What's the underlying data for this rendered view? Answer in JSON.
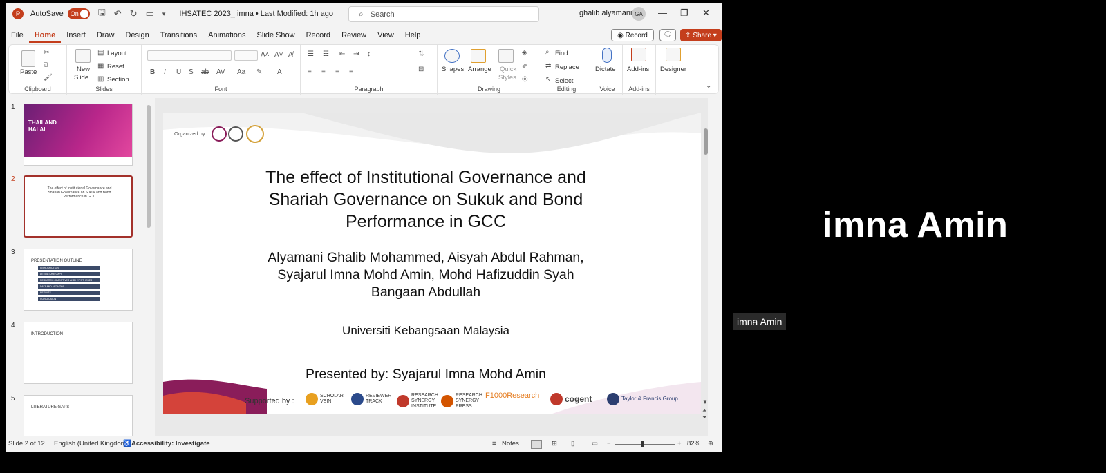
{
  "titlebar": {
    "autosave_label": "AutoSave",
    "autosave_state": "On",
    "doc_title": "IHSATEC 2023_ imna • Last Modified: 1h ago",
    "search_placeholder": "Search",
    "user_name": "ghalib alyamani",
    "user_initials": "GA"
  },
  "menu": [
    "File",
    "Home",
    "Insert",
    "Draw",
    "Design",
    "Transitions",
    "Animations",
    "Slide Show",
    "Record",
    "Review",
    "View",
    "Help"
  ],
  "menu_active": "Home",
  "actions": {
    "record": "Record",
    "share": "Share"
  },
  "ribbon": {
    "clipboard": {
      "label": "Clipboard",
      "paste": "Paste"
    },
    "slides": {
      "label": "Slides",
      "new_slide": "New",
      "new_slide2": "Slide",
      "layout": "Layout",
      "reset": "Reset",
      "section": "Section"
    },
    "font": {
      "label": "Font"
    },
    "paragraph": {
      "label": "Paragraph"
    },
    "drawing": {
      "label": "Drawing",
      "shapes": "Shapes",
      "arrange": "Arrange",
      "quick": "Quick",
      "styles": "Styles"
    },
    "editing": {
      "label": "Editing",
      "find": "Find",
      "replace": "Replace",
      "select": "Select"
    },
    "voice": {
      "label": "Voice",
      "dictate": "Dictate"
    },
    "addins": {
      "label": "Add-ins",
      "addins": "Add-ins",
      "designer": "Designer"
    }
  },
  "thumbnails": {
    "numbers": [
      "1",
      "2",
      "3",
      "4",
      "5"
    ],
    "t1_title": "THAILAND HALAL",
    "t2_lines": [
      "The effect of Institutional Governance and",
      "Shariah Governance on Sukuk and Bond",
      "Performance in GCC"
    ],
    "t3_head": "PRESENTATION OUTLINE",
    "t3_items": [
      "INTRODUCTION",
      "LITERATURE GAPS",
      "RESEARCH OBJECTIVES AND HYPOTHESES",
      "DATA AND METHODS",
      "RESULTS",
      "CONCLUSION"
    ],
    "t4_head": "INTRODUCTION",
    "t5_head": "LITERATURE GAPS"
  },
  "slide": {
    "organized_by": "Organized by :",
    "title_lines": [
      "The effect of Institutional Governance and",
      "Shariah Governance on Sukuk and Bond",
      "Performance in GCC"
    ],
    "author_lines": [
      "Alyamani Ghalib Mohammed, Aisyah Abdul Rahman,",
      "Syajarul Imna Mohd Amin,  Mohd Hafizuddin Syah",
      "Bangaan Abdullah"
    ],
    "university": "Universiti Kebangsaan Malaysia",
    "presenter": "Presented by: Syajarul Imna Mohd Amin",
    "supported_by": "Supported by :",
    "sponsors": [
      {
        "name": "SCHOLAR VEIN",
        "color": "#e8a020"
      },
      {
        "name": "REVIEWER TRACK",
        "color": "#2b4a8b"
      },
      {
        "name": "RESEARCH SYNERGY INSTITUTE",
        "color": "#c0392b"
      },
      {
        "name": "RESEARCH SYNERGY PRESS",
        "color": "#d35400"
      },
      {
        "name": "F1000Research",
        "color": "#e67e22"
      },
      {
        "name": "cogent",
        "color": "#c0392b"
      },
      {
        "name": "Taylor & Francis Group",
        "color": "#2c3e70"
      }
    ]
  },
  "status": {
    "slide_info": "Slide 2 of 12",
    "language": "English (United Kingdom)",
    "accessibility": "Accessibility: Investigate",
    "notes": "Notes",
    "zoom": "82%"
  },
  "meeting": {
    "big_name": "imna Amin",
    "name_tag": "imna Amin"
  }
}
